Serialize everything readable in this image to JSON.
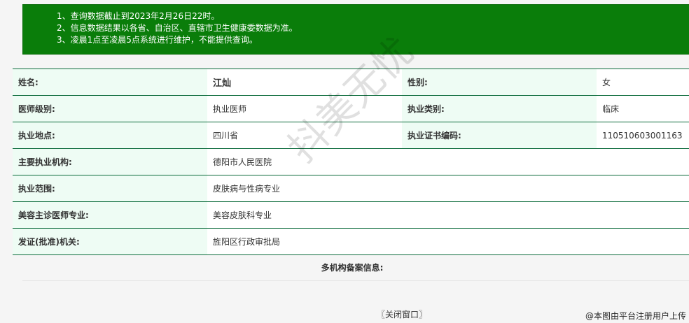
{
  "notice": {
    "lines": [
      "1、查询数据截止到2023年2月26日22时。",
      "2、信息数据结果以各省、自治区、直辖市卫生健康委数据为准。",
      "3、凌晨1点至凌晨5点系统进行维护，不能提供查询。"
    ]
  },
  "info": {
    "name_label": "姓名:",
    "name_value": "江灿",
    "gender_label": "性别:",
    "gender_value": "女",
    "level_label": "医师级别:",
    "level_value": "执业医师",
    "category_label": "执业类别:",
    "category_value": "临床",
    "location_label": "执业地点:",
    "location_value": "四川省",
    "cert_label": "执业证书编码:",
    "cert_value": "110510603001163",
    "institution_label": "主要执业机构:",
    "institution_value": "德阳市人民医院",
    "scope_label": "执业范围:",
    "scope_value": "皮肤病与性病专业",
    "beauty_label": "美容主诊医师专业:",
    "beauty_value": "美容皮肤科专业",
    "issuer_label": "发证(批准)机关:",
    "issuer_value": "旌阳区行政审批局"
  },
  "multi_label": "多机构备案信息:",
  "close_label": "〖关闭窗口〗",
  "watermark": {
    "center": "抖美无忧",
    "corner": "@本图由平台注册用户上传"
  }
}
